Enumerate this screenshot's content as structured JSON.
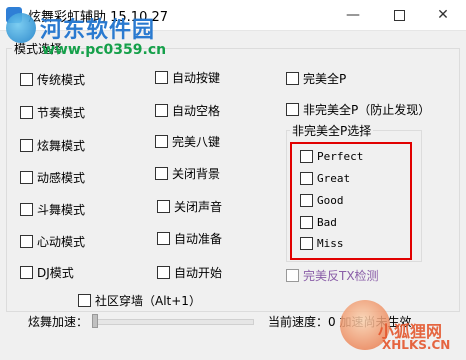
{
  "window": {
    "title": "炫舞彩虹辅助 15.10.27",
    "minimize": "—",
    "close": "✕"
  },
  "watermark": {
    "title": "河东软件园",
    "url": "www.pc0359.cn",
    "bottom_title": "小狐狸网",
    "bottom_url": "XHLKS.CN"
  },
  "group": {
    "legend": "模式选择"
  },
  "col1": [
    "传统模式",
    "节奏模式",
    "炫舞模式",
    "动感模式",
    "斗舞模式",
    "心动模式",
    "DJ模式"
  ],
  "col2": [
    "自动按键",
    "自动空格",
    "完美八键",
    "关闭背景",
    "关闭声音",
    "自动准备",
    "自动开始"
  ],
  "col3": {
    "perfect_p": "完美全P",
    "non_perfect_p": "非完美全P（防止发现）",
    "inner_legend": "非完美全P选择",
    "options": [
      "Perfect",
      "Great",
      "Good",
      "Bad",
      "Miss"
    ],
    "anti_tx": "完美反TX检测"
  },
  "wall": "社区穿墙（Alt+1）",
  "slider": {
    "label": "炫舞加速：",
    "value_fraction": 0
  },
  "speed": "当前速度：0 加速尚未生效",
  "colors": {
    "highlight_border": "#e10000",
    "disabled_text": "#8a5ea8",
    "watermark_blue": "#2a7ad0",
    "watermark_green": "#15a04a"
  }
}
